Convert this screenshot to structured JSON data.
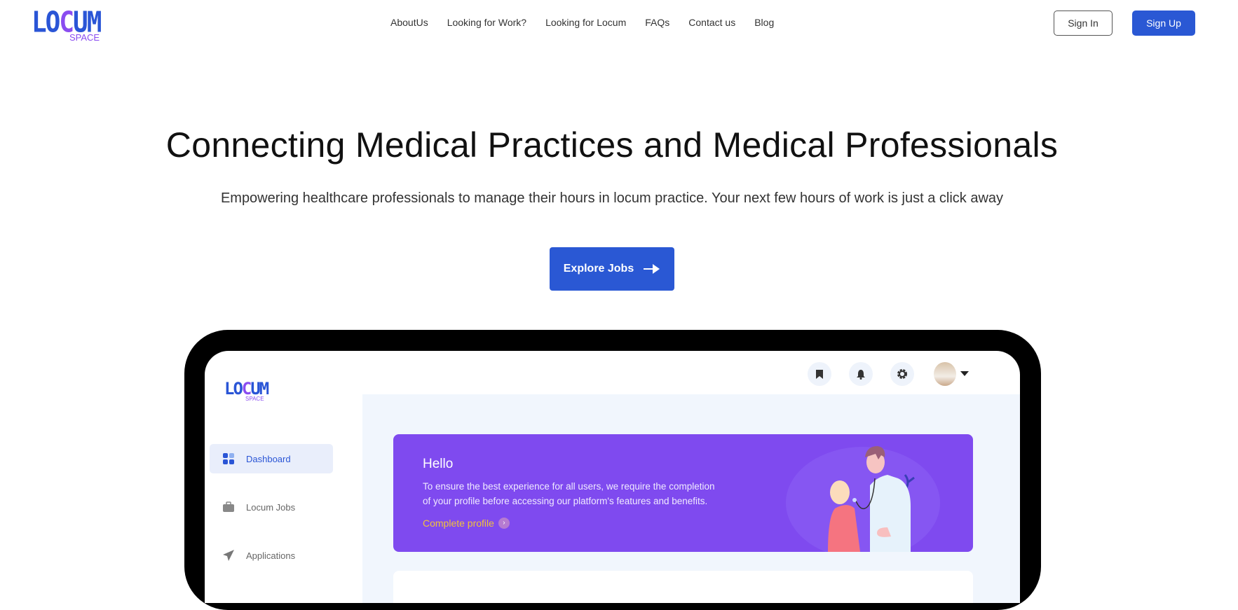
{
  "header": {
    "logo_main": "LOCUM",
    "logo_sub": "SPACE",
    "nav": [
      "AboutUs",
      "Looking for Work?",
      "Looking for Locum",
      "FAQs",
      "Contact us",
      "Blog"
    ],
    "sign_in": "Sign In",
    "sign_up": "Sign Up"
  },
  "hero": {
    "title": "Connecting Medical Practices and Medical Professionals",
    "subtitle": "Empowering healthcare professionals to manage their hours in locum practice. Your next few hours of work is just a click away",
    "cta": "Explore Jobs"
  },
  "preview": {
    "logo_main": "LOCUM",
    "logo_sub": "SPACE",
    "sidebar": [
      "Dashboard",
      "Locum Jobs",
      "Applications"
    ],
    "banner": {
      "greeting": "Hello",
      "message": "To ensure the best experience for all users, we require the completion of your profile before accessing our platform's features and benefits.",
      "link": "Complete profile"
    }
  },
  "colors": {
    "primary": "#2a58d4",
    "accent": "#7f4aef",
    "link": "#f2c23b"
  }
}
